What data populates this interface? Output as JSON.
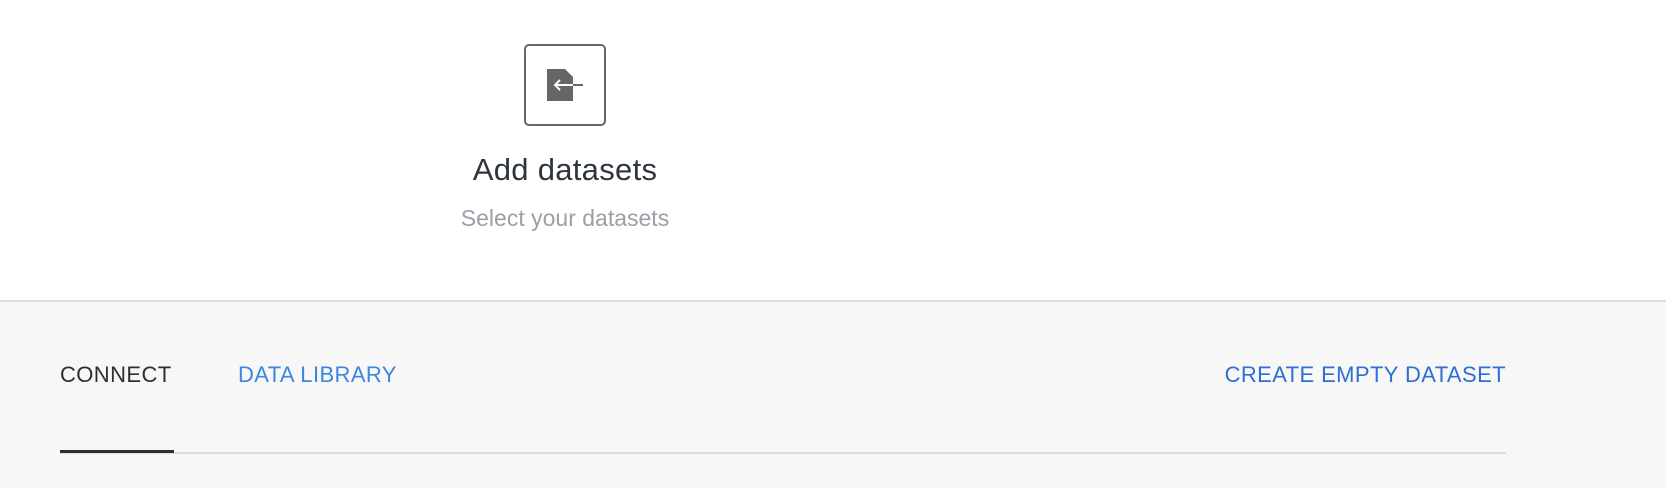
{
  "step": {
    "icon": "import-file-icon",
    "title": "Add datasets",
    "subtitle": "Select your datasets"
  },
  "tabs": [
    {
      "label": "CONNECT",
      "active": true
    },
    {
      "label": "DATA LIBRARY",
      "active": false
    }
  ],
  "actions": {
    "create_empty_label": "CREATE EMPTY DATASET"
  },
  "colors": {
    "link": "#3d86e0",
    "active_tab": "#2f2f2f",
    "panel_bg": "#f7f7f7"
  }
}
